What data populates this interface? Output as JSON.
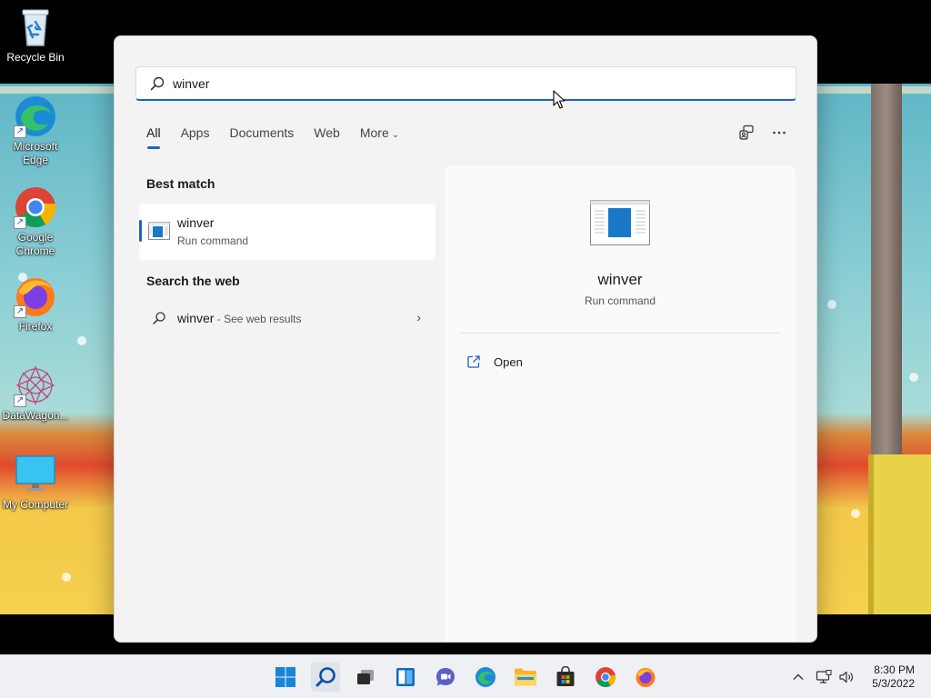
{
  "desktop": {
    "icons": [
      {
        "label": "Recycle Bin",
        "icon": "recycle-bin-icon"
      },
      {
        "label": "Microsoft Edge",
        "icon": "edge-icon"
      },
      {
        "label": "Google Chrome",
        "icon": "chrome-icon"
      },
      {
        "label": "Firefox",
        "icon": "firefox-icon"
      },
      {
        "label": "DataWagon...",
        "icon": "datawagon-icon"
      },
      {
        "label": "My Computer",
        "icon": "monitor-icon"
      }
    ]
  },
  "search": {
    "value": "winver",
    "placeholder": ""
  },
  "tabs": [
    {
      "label": "All",
      "active": true
    },
    {
      "label": "Apps"
    },
    {
      "label": "Documents"
    },
    {
      "label": "Web"
    },
    {
      "label": "More",
      "has_dropdown": true
    }
  ],
  "toolbar": {
    "feedback_icon": "share-feedback-icon",
    "more_icon": "more-options-icon"
  },
  "best_match": {
    "title": "Best match",
    "item": {
      "name": "winver",
      "type": "Run command",
      "icon": "window-app-icon"
    }
  },
  "web": {
    "title": "Search the web",
    "item": {
      "query": "winver",
      "suffix": " - See web results",
      "icon": "search-icon"
    }
  },
  "detail": {
    "name": "winver",
    "type": "Run command",
    "actions": [
      {
        "label": "Open",
        "icon": "open-external-icon"
      }
    ]
  },
  "taskbar": {
    "apps": [
      {
        "name": "Start",
        "icon": "windows-start-icon"
      },
      {
        "name": "Search",
        "icon": "search-icon",
        "active": true
      },
      {
        "name": "Task View",
        "icon": "task-view-icon"
      },
      {
        "name": "Widgets",
        "icon": "widgets-icon"
      },
      {
        "name": "Chat",
        "icon": "chat-icon"
      },
      {
        "name": "Microsoft Edge",
        "icon": "edge-icon"
      },
      {
        "name": "File Explorer",
        "icon": "folder-icon"
      },
      {
        "name": "Microsoft Store",
        "icon": "store-icon"
      },
      {
        "name": "Google Chrome",
        "icon": "chrome-icon"
      },
      {
        "name": "Firefox",
        "icon": "firefox-icon"
      }
    ],
    "tray": [
      "chevron-up-icon",
      "network-icon",
      "volume-icon"
    ],
    "time": "8:30 PM",
    "date": "5/3/2022"
  },
  "colors": {
    "accent": "#1f62b8",
    "panel_bg": "#f3f3f3",
    "taskbar_bg": "#eef0f3"
  }
}
